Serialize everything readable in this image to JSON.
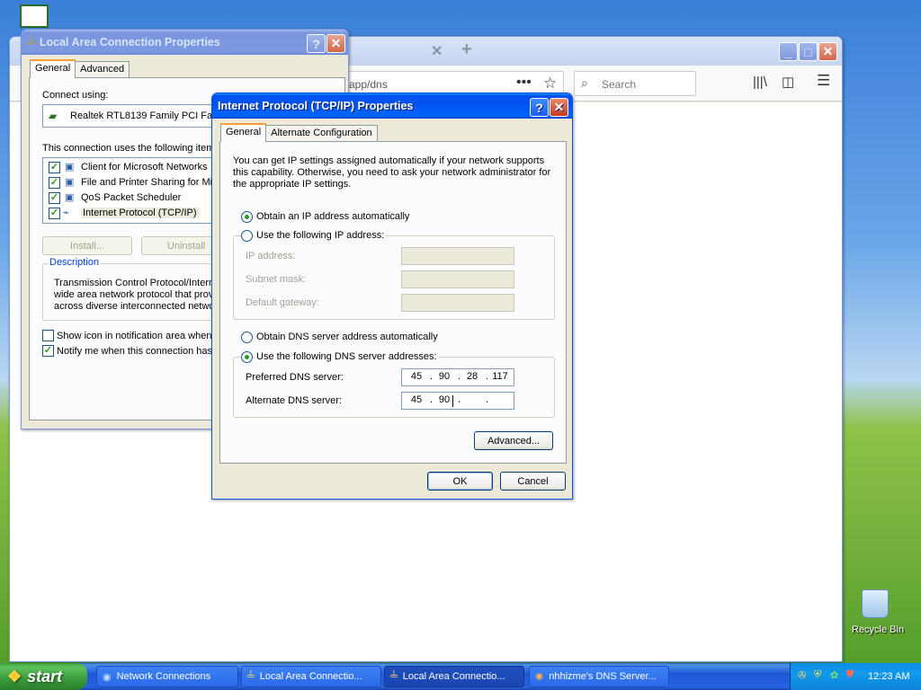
{
  "desktop": {
    "recycle_bin": "Recycle Bin"
  },
  "firefox": {
    "url": "app/dns",
    "search_placeholder": "Search"
  },
  "lac_window": {
    "title": "Local Area Connection Properties",
    "tabs": [
      "General",
      "Advanced"
    ],
    "connect_using_label": "Connect using:",
    "adapter": "Realtek RTL8139 Family PCI Fas",
    "uses_items_label": "This connection uses the following items",
    "items": [
      {
        "label": "Client for Microsoft Networks",
        "checked": true
      },
      {
        "label": "File and Printer Sharing for Mic",
        "checked": true
      },
      {
        "label": "QoS Packet Scheduler",
        "checked": true
      },
      {
        "label": "Internet Protocol (TCP/IP)",
        "checked": true
      }
    ],
    "install_label": "Install...",
    "uninstall_label": "Uninstall",
    "description_title": "Description",
    "description_lines": [
      "Transmission Control Protocol/Interne",
      "wide area network protocol that provi",
      "across diverse interconnected netwo"
    ],
    "show_icon_label": "Show icon in notification area when",
    "notify_label": "Notify me when this connection has"
  },
  "tcpip_window": {
    "title": "Internet Protocol (TCP/IP) Properties",
    "tabs": [
      "General",
      "Alternate Configuration"
    ],
    "intro_lines": [
      "You can get IP settings assigned automatically if your network supports",
      "this capability. Otherwise, you need to ask your network administrator for",
      "the appropriate IP settings."
    ],
    "obtain_ip_auto": "Obtain an IP address automatically",
    "use_following_ip": "Use the following IP address:",
    "ip_address_label": "IP address:",
    "subnet_mask_label": "Subnet mask:",
    "default_gateway_label": "Default gateway:",
    "obtain_dns_auto": "Obtain DNS server address automatically",
    "use_following_dns": "Use the following DNS server addresses:",
    "preferred_dns_label": "Preferred DNS server:",
    "preferred_dns": [
      "45",
      "90",
      "28",
      "117"
    ],
    "alternate_dns_label": "Alternate DNS server:",
    "alternate_dns": [
      "45",
      "90",
      "",
      ""
    ],
    "advanced_label": "Advanced...",
    "ok_label": "OK",
    "cancel_label": "Cancel"
  },
  "taskbar": {
    "start_label": "start",
    "buttons": [
      "Network Connections",
      "Local Area Connectio...",
      "Local Area Connectio...",
      "nhhizme's DNS Server..."
    ],
    "clock": "12:23 AM"
  }
}
